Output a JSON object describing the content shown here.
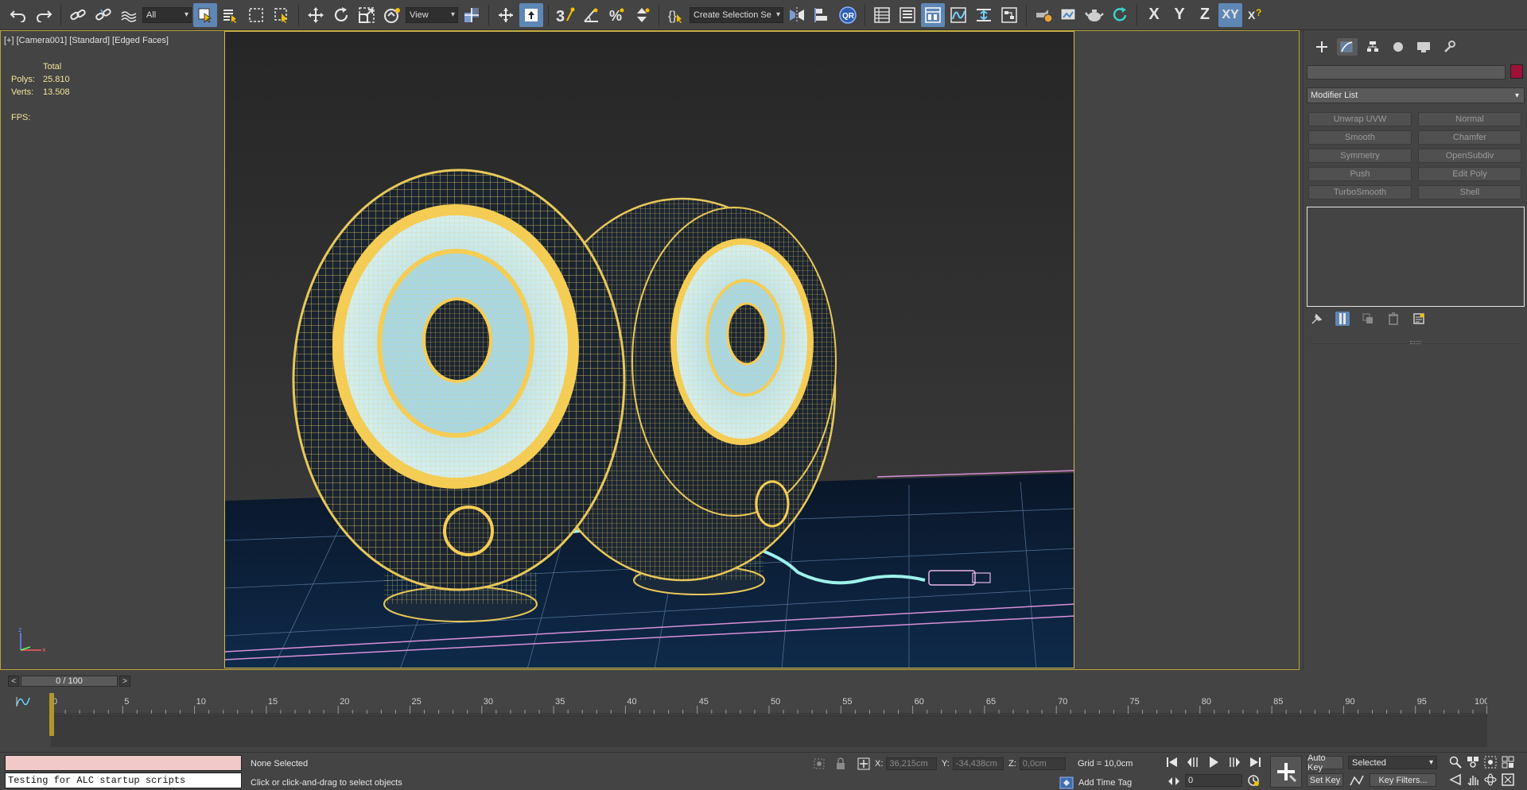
{
  "toolbar": {
    "filter": "All",
    "ref_coord": "View",
    "selection_set": "Create Selection Se",
    "axes": [
      "X",
      "Y",
      "Z",
      "XY"
    ],
    "active_axis": "XY"
  },
  "viewport": {
    "label": "[+] [Camera001] [Standard] [Edged Faces]",
    "stats": {
      "header": "Total",
      "polys_label": "Polys:",
      "polys_value": "25.810",
      "verts_label": "Verts:",
      "verts_value": "13.508",
      "fps_label": "FPS:"
    }
  },
  "command_panel": {
    "modifier_list": "Modifier List",
    "object_color": "#a0113a",
    "modifiers": [
      "Unwrap UVW",
      "Normal",
      "Smooth",
      "Chamfer",
      "Symmetry",
      "OpenSubdiv",
      "Push",
      "Edit Poly",
      "TurboSmooth",
      "Shell"
    ]
  },
  "timeline": {
    "slider_label": "0 / 100",
    "ticks": [
      "0",
      "5",
      "10",
      "15",
      "20",
      "25",
      "30",
      "35",
      "40",
      "45",
      "50",
      "55",
      "60",
      "65",
      "70",
      "75",
      "80",
      "85",
      "90",
      "95",
      "100"
    ]
  },
  "status": {
    "maxscript_output": "Testing for ALC startup scripts",
    "selection": "None Selected",
    "prompt": "Click or click-and-drag to select objects",
    "x_label": "X:",
    "x_value": "36,215cm",
    "y_label": "Y:",
    "y_value": "-34,438cm",
    "z_label": "Z:",
    "z_value": "0,0cm",
    "grid": "Grid = 10,0cm",
    "add_time_tag": "Add Time Tag",
    "current_frame": "0",
    "auto_key": "Auto Key",
    "set_key": "Set Key",
    "key_mode": "Selected",
    "key_filters": "Key Filters..."
  }
}
